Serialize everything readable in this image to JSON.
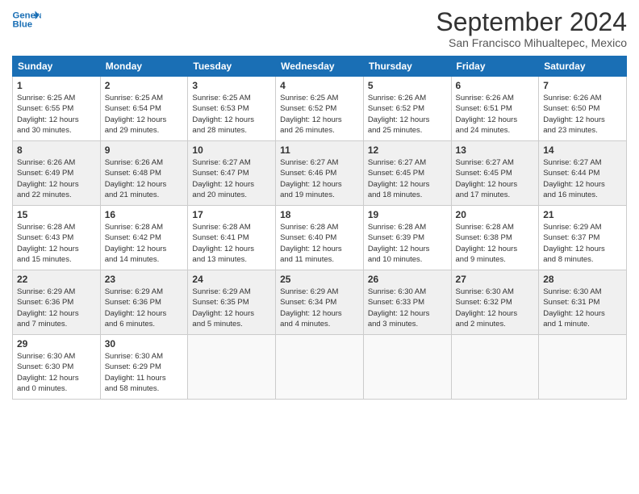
{
  "header": {
    "logo_line1": "General",
    "logo_line2": "Blue",
    "title": "September 2024",
    "subtitle": "San Francisco Mihualtepec, Mexico"
  },
  "weekdays": [
    "Sunday",
    "Monday",
    "Tuesday",
    "Wednesday",
    "Thursday",
    "Friday",
    "Saturday"
  ],
  "weeks": [
    [
      {
        "day": "1",
        "info": "Sunrise: 6:25 AM\nSunset: 6:55 PM\nDaylight: 12 hours\nand 30 minutes."
      },
      {
        "day": "2",
        "info": "Sunrise: 6:25 AM\nSunset: 6:54 PM\nDaylight: 12 hours\nand 29 minutes."
      },
      {
        "day": "3",
        "info": "Sunrise: 6:25 AM\nSunset: 6:53 PM\nDaylight: 12 hours\nand 28 minutes."
      },
      {
        "day": "4",
        "info": "Sunrise: 6:25 AM\nSunset: 6:52 PM\nDaylight: 12 hours\nand 26 minutes."
      },
      {
        "day": "5",
        "info": "Sunrise: 6:26 AM\nSunset: 6:52 PM\nDaylight: 12 hours\nand 25 minutes."
      },
      {
        "day": "6",
        "info": "Sunrise: 6:26 AM\nSunset: 6:51 PM\nDaylight: 12 hours\nand 24 minutes."
      },
      {
        "day": "7",
        "info": "Sunrise: 6:26 AM\nSunset: 6:50 PM\nDaylight: 12 hours\nand 23 minutes."
      }
    ],
    [
      {
        "day": "8",
        "info": "Sunrise: 6:26 AM\nSunset: 6:49 PM\nDaylight: 12 hours\nand 22 minutes."
      },
      {
        "day": "9",
        "info": "Sunrise: 6:26 AM\nSunset: 6:48 PM\nDaylight: 12 hours\nand 21 minutes."
      },
      {
        "day": "10",
        "info": "Sunrise: 6:27 AM\nSunset: 6:47 PM\nDaylight: 12 hours\nand 20 minutes."
      },
      {
        "day": "11",
        "info": "Sunrise: 6:27 AM\nSunset: 6:46 PM\nDaylight: 12 hours\nand 19 minutes."
      },
      {
        "day": "12",
        "info": "Sunrise: 6:27 AM\nSunset: 6:45 PM\nDaylight: 12 hours\nand 18 minutes."
      },
      {
        "day": "13",
        "info": "Sunrise: 6:27 AM\nSunset: 6:45 PM\nDaylight: 12 hours\nand 17 minutes."
      },
      {
        "day": "14",
        "info": "Sunrise: 6:27 AM\nSunset: 6:44 PM\nDaylight: 12 hours\nand 16 minutes."
      }
    ],
    [
      {
        "day": "15",
        "info": "Sunrise: 6:28 AM\nSunset: 6:43 PM\nDaylight: 12 hours\nand 15 minutes."
      },
      {
        "day": "16",
        "info": "Sunrise: 6:28 AM\nSunset: 6:42 PM\nDaylight: 12 hours\nand 14 minutes."
      },
      {
        "day": "17",
        "info": "Sunrise: 6:28 AM\nSunset: 6:41 PM\nDaylight: 12 hours\nand 13 minutes."
      },
      {
        "day": "18",
        "info": "Sunrise: 6:28 AM\nSunset: 6:40 PM\nDaylight: 12 hours\nand 11 minutes."
      },
      {
        "day": "19",
        "info": "Sunrise: 6:28 AM\nSunset: 6:39 PM\nDaylight: 12 hours\nand 10 minutes."
      },
      {
        "day": "20",
        "info": "Sunrise: 6:28 AM\nSunset: 6:38 PM\nDaylight: 12 hours\nand 9 minutes."
      },
      {
        "day": "21",
        "info": "Sunrise: 6:29 AM\nSunset: 6:37 PM\nDaylight: 12 hours\nand 8 minutes."
      }
    ],
    [
      {
        "day": "22",
        "info": "Sunrise: 6:29 AM\nSunset: 6:36 PM\nDaylight: 12 hours\nand 7 minutes."
      },
      {
        "day": "23",
        "info": "Sunrise: 6:29 AM\nSunset: 6:36 PM\nDaylight: 12 hours\nand 6 minutes."
      },
      {
        "day": "24",
        "info": "Sunrise: 6:29 AM\nSunset: 6:35 PM\nDaylight: 12 hours\nand 5 minutes."
      },
      {
        "day": "25",
        "info": "Sunrise: 6:29 AM\nSunset: 6:34 PM\nDaylight: 12 hours\nand 4 minutes."
      },
      {
        "day": "26",
        "info": "Sunrise: 6:30 AM\nSunset: 6:33 PM\nDaylight: 12 hours\nand 3 minutes."
      },
      {
        "day": "27",
        "info": "Sunrise: 6:30 AM\nSunset: 6:32 PM\nDaylight: 12 hours\nand 2 minutes."
      },
      {
        "day": "28",
        "info": "Sunrise: 6:30 AM\nSunset: 6:31 PM\nDaylight: 12 hours\nand 1 minute."
      }
    ],
    [
      {
        "day": "29",
        "info": "Sunrise: 6:30 AM\nSunset: 6:30 PM\nDaylight: 12 hours\nand 0 minutes."
      },
      {
        "day": "30",
        "info": "Sunrise: 6:30 AM\nSunset: 6:29 PM\nDaylight: 11 hours\nand 58 minutes."
      },
      {
        "day": "",
        "info": ""
      },
      {
        "day": "",
        "info": ""
      },
      {
        "day": "",
        "info": ""
      },
      {
        "day": "",
        "info": ""
      },
      {
        "day": "",
        "info": ""
      }
    ]
  ]
}
